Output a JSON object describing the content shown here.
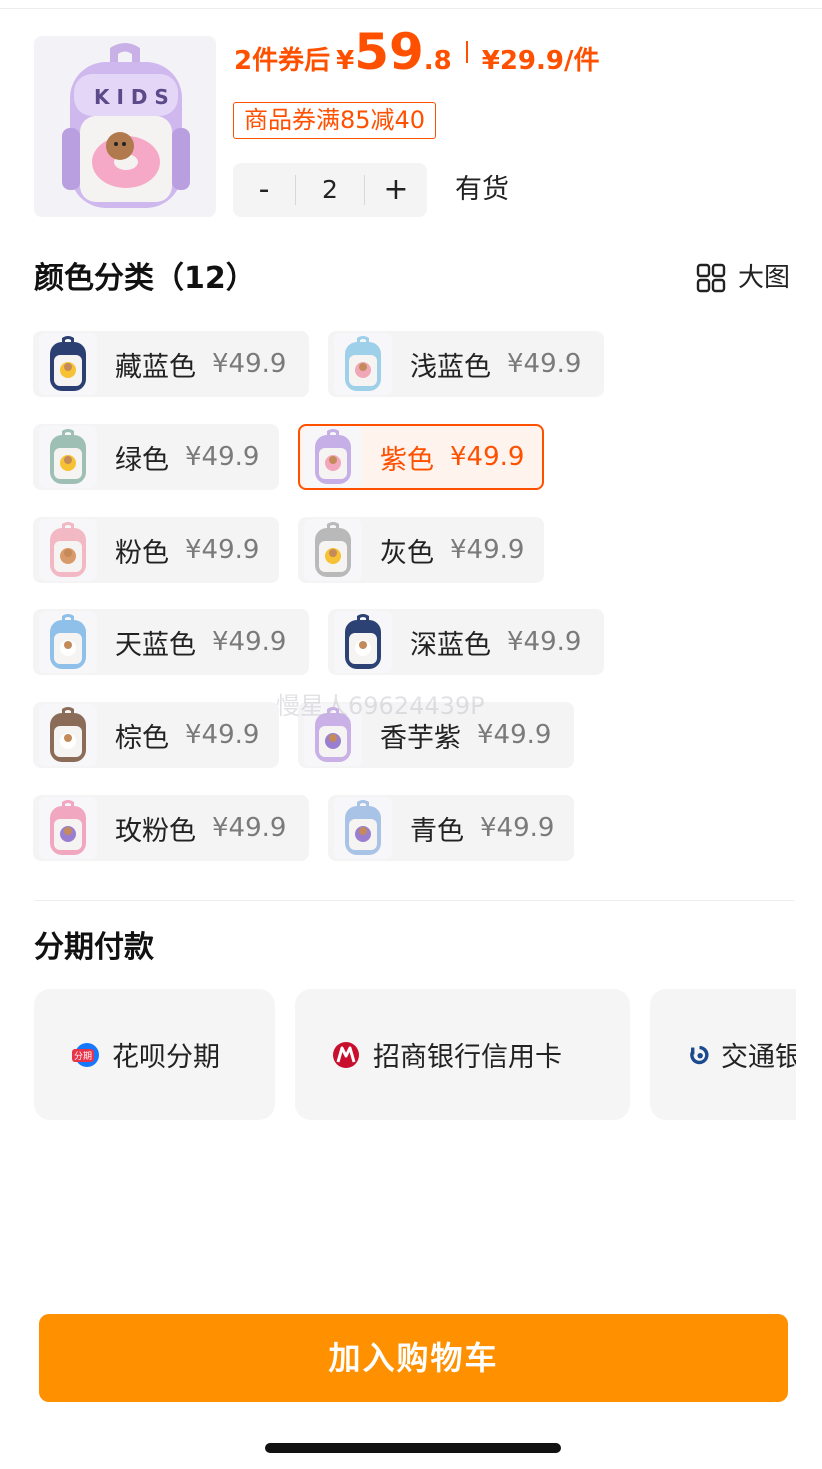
{
  "header": {
    "price_prefix": "2件券后",
    "currency": "¥",
    "price_int": "59",
    "price_dec": ".8",
    "unit_price": "¥29.9/件",
    "coupon": "商品券满85减40",
    "stepper_minus": "-",
    "quantity": "2",
    "stepper_plus": "+",
    "stock": "有货"
  },
  "colors": {
    "title": "颜色分类（12）",
    "big_view": "大图",
    "items": [
      {
        "name": "藏蓝色",
        "price": "¥49.9",
        "tone": "#2c3f72",
        "accent": "#f6c133"
      },
      {
        "name": "浅蓝色",
        "price": "¥49.9",
        "tone": "#9fd0ea",
        "accent": "#f0a8b8"
      },
      {
        "name": "绿色",
        "price": "¥49.9",
        "tone": "#9ec0b4",
        "accent": "#f6c133"
      },
      {
        "name": "紫色",
        "price": "¥49.9",
        "tone": "#c6aee6",
        "accent": "#f3a7bd",
        "selected": true
      },
      {
        "name": "粉色",
        "price": "¥49.9",
        "tone": "#f2b9c4",
        "accent": "#d99a6a"
      },
      {
        "name": "灰色",
        "price": "¥49.9",
        "tone": "#b9b9b9",
        "accent": "#f6c133"
      },
      {
        "name": "天蓝色",
        "price": "¥49.9",
        "tone": "#8ec0ea",
        "accent": "#ffffff"
      },
      {
        "name": "深蓝色",
        "price": "¥49.9",
        "tone": "#2d4274",
        "accent": "#ffffff"
      },
      {
        "name": "棕色",
        "price": "¥49.9",
        "tone": "#8a6c58",
        "accent": "#ffffff"
      },
      {
        "name": "香芋紫",
        "price": "¥49.9",
        "tone": "#c9b0e6",
        "accent": "#9a7fd0"
      },
      {
        "name": "玫粉色",
        "price": "¥49.9",
        "tone": "#f1a7bf",
        "accent": "#9a7fd0"
      },
      {
        "name": "青色",
        "price": "¥49.9",
        "tone": "#a9c3e6",
        "accent": "#9a7fd0"
      }
    ]
  },
  "installment": {
    "title": "分期付款",
    "options": [
      {
        "label": "花呗分期",
        "icon": "huabei-icon",
        "icon_text": "分期"
      },
      {
        "label": "招商银行信用卡",
        "icon": "cmb-bank-icon"
      },
      {
        "label": "交通银行信用卡",
        "icon": "bocom-bank-icon"
      }
    ]
  },
  "watermark": "慢星人69624439P",
  "cart_button": "加入购物车",
  "brand_colors": {
    "accent": "#ff5000",
    "cart": "#ff9000",
    "cmb": "#c8102e",
    "bocom": "#1b4a8f",
    "huabei": "#1677ff"
  }
}
